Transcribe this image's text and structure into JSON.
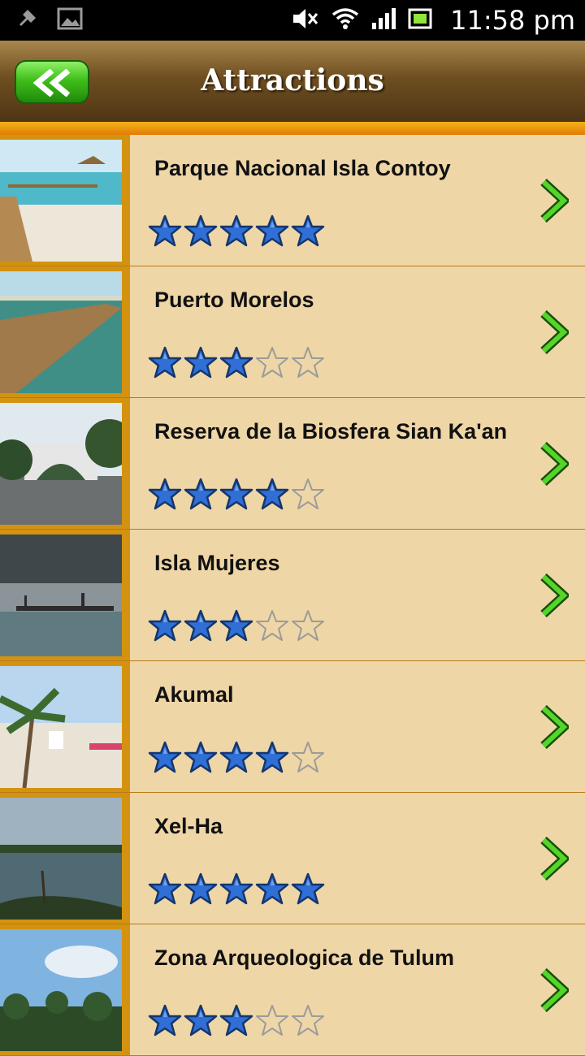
{
  "status_bar": {
    "time": "11:58 pm",
    "icons": [
      "notification-icon",
      "image-icon",
      "mute-icon",
      "wifi-icon",
      "signal-icon",
      "battery-icon"
    ]
  },
  "header": {
    "title": "Attractions",
    "back_icon": "double-chevron-left-icon"
  },
  "colors": {
    "header_top": "#a9874d",
    "header_bottom": "#4f3514",
    "accent_orange": "#e27c05",
    "row_bg": "#efd6a6",
    "star_filled": "#2f6fd6",
    "chevron_green": "#3fbf1a"
  },
  "attractions": [
    {
      "name": "Parque Nacional Isla Contoy",
      "rating": 5,
      "image_scene": "pier-beach"
    },
    {
      "name": "Puerto Morelos",
      "rating": 3,
      "image_scene": "pier-water"
    },
    {
      "name": "Reserva de la Biosfera Sian Ka'an",
      "rating": 4,
      "image_scene": "arch-road"
    },
    {
      "name": "Isla Mujeres",
      "rating": 3,
      "image_scene": "storm-pier"
    },
    {
      "name": "Akumal",
      "rating": 4,
      "image_scene": "palm-beach"
    },
    {
      "name": "Xel-Ha",
      "rating": 5,
      "image_scene": "lagoon"
    },
    {
      "name": "Zona Arqueologica de Tulum",
      "rating": 3,
      "image_scene": "jungle-sky"
    }
  ]
}
